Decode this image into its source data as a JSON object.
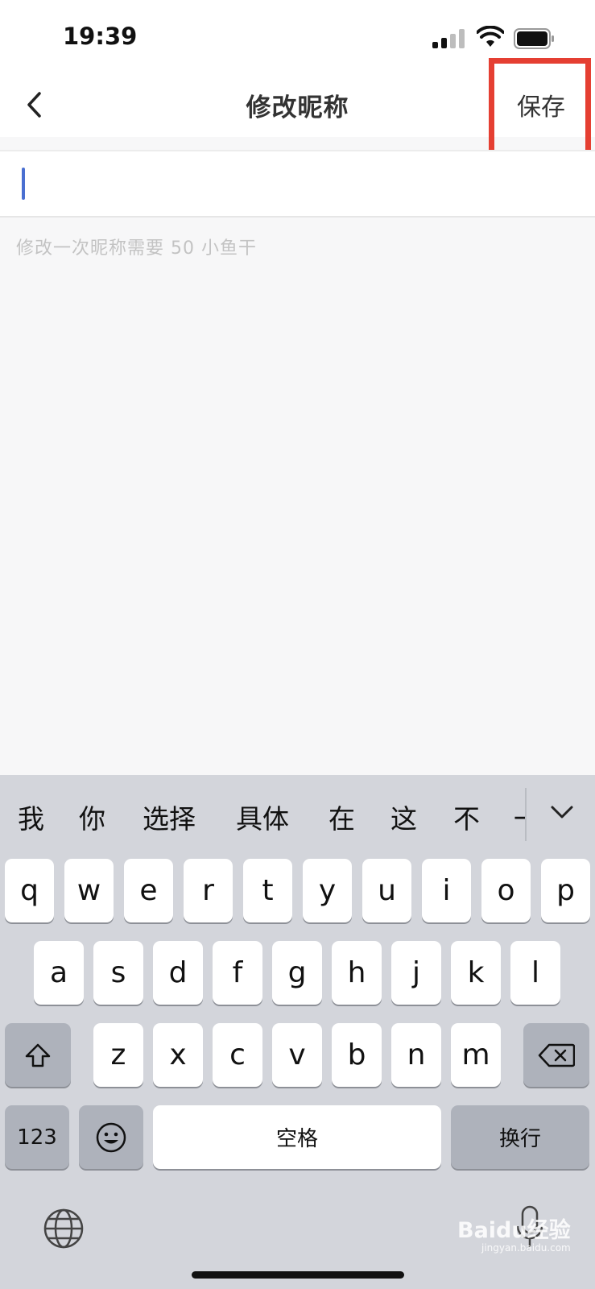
{
  "status_bar": {
    "time": "19:39"
  },
  "nav": {
    "title": "修改昵称",
    "save_label": "保存"
  },
  "input": {
    "value": "",
    "placeholder": ""
  },
  "hint": "修改一次昵称需要 50 小鱼干",
  "keyboard": {
    "suggestions": [
      "我",
      "你",
      "选择",
      "具体",
      "在",
      "这",
      "不",
      "一"
    ],
    "row1": [
      "q",
      "w",
      "e",
      "r",
      "t",
      "y",
      "u",
      "i",
      "o",
      "p"
    ],
    "row2": [
      "a",
      "s",
      "d",
      "f",
      "g",
      "h",
      "j",
      "k",
      "l"
    ],
    "row3": [
      "z",
      "x",
      "c",
      "v",
      "b",
      "n",
      "m"
    ],
    "numbers_label": "123",
    "space_label": "空格",
    "return_label": "换行"
  },
  "watermark": {
    "brand": "Baidu经验",
    "url": "jingyan.baidu.com"
  },
  "colors": {
    "highlight": "#e53f32",
    "caret": "#4a6fd1",
    "keyboard_bg": "#d3d5db",
    "function_key": "#aeb2bb"
  }
}
